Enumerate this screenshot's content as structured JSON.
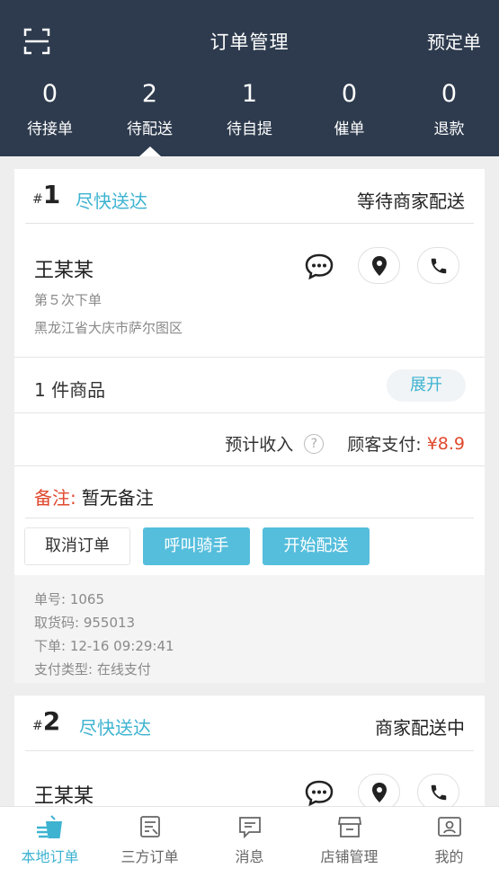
{
  "header": {
    "title": "订单管理",
    "reserve_label": "预定单",
    "scan_icon": "scan-icon"
  },
  "stats": [
    {
      "count": "0",
      "label": "待接单"
    },
    {
      "count": "2",
      "label": "待配送"
    },
    {
      "count": "1",
      "label": "待自提"
    },
    {
      "count": "0",
      "label": "催单"
    },
    {
      "count": "0",
      "label": "退款"
    }
  ],
  "active_stat": "待配送",
  "orders": [
    {
      "hash": "#",
      "number": "1",
      "delivery": "尽快送达",
      "status": "等待商家配送",
      "customer": "王某某",
      "order_count_text": "第５次下单",
      "address": "黑龙江省大庆市萨尔图区",
      "goods": "1 件商品",
      "expand_label": "展开",
      "income_label": "预计收入",
      "pay_label": "顾客支付:",
      "pay_amount": "¥8.9",
      "note_label": "备注:",
      "note_value": "暂无备注",
      "actions": {
        "cancel": "取消订单",
        "call_rider": "呼叫骑手",
        "start_delivery": "开始配送"
      },
      "info": {
        "order_no": "单号: 1065",
        "pickup_code": "取货码: 955013",
        "order_time": "下单: 12-16 09:29:41",
        "pay_type": "支付类型: 在线支付"
      }
    },
    {
      "hash": "#",
      "number": "2",
      "delivery": "尽快送达",
      "status": "商家配送中",
      "customer": "王某某"
    }
  ],
  "bottom_nav": [
    {
      "label": "本地订单",
      "icon": "drink-cup-icon",
      "active": true
    },
    {
      "label": "三方订单",
      "icon": "third-party-order-icon",
      "active": false
    },
    {
      "label": "消息",
      "icon": "message-icon",
      "active": false
    },
    {
      "label": "店铺管理",
      "icon": "store-icon",
      "active": false
    },
    {
      "label": "我的",
      "icon": "profile-icon",
      "active": false
    }
  ],
  "colors": {
    "header_bg": "#2e3b4e",
    "accent": "#3eb3d1",
    "button_blue": "#55bedc",
    "price_red": "#e0492e"
  }
}
